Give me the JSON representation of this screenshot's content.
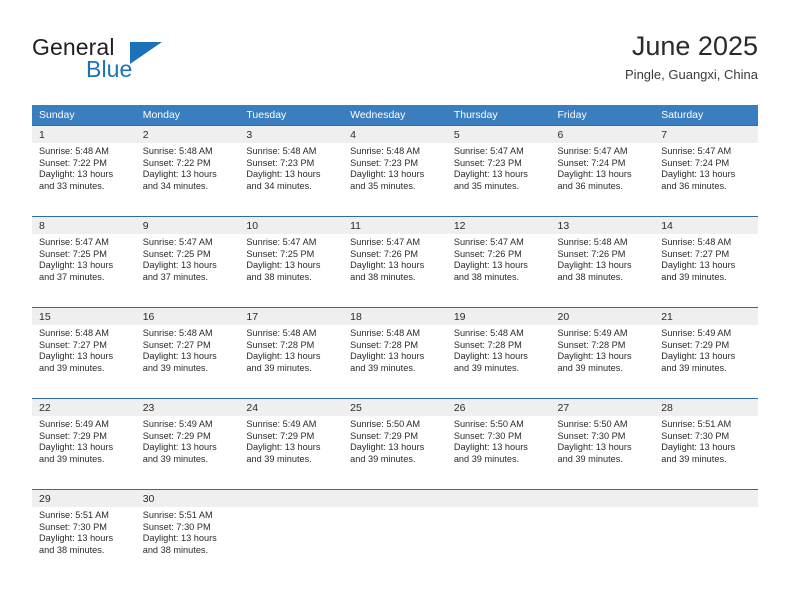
{
  "brand": {
    "name_top": "General",
    "name_bottom": "Blue",
    "accent_color": "#1b72b8"
  },
  "header": {
    "month_title": "June 2025",
    "location": "Pingle, Guangxi, China"
  },
  "theme": {
    "header_row_bg": "#3a7ec0",
    "row_divider": "#2c6ca8",
    "daynum_band_bg": "#efefef",
    "text_color": "#2b2b2b"
  },
  "calendar": {
    "weekday_headers": [
      "Sunday",
      "Monday",
      "Tuesday",
      "Wednesday",
      "Thursday",
      "Friday",
      "Saturday"
    ],
    "weeks": [
      [
        {
          "day": "1",
          "sunrise": "Sunrise: 5:48 AM",
          "sunset": "Sunset: 7:22 PM",
          "daylight_1": "Daylight: 13 hours",
          "daylight_2": "and 33 minutes."
        },
        {
          "day": "2",
          "sunrise": "Sunrise: 5:48 AM",
          "sunset": "Sunset: 7:22 PM",
          "daylight_1": "Daylight: 13 hours",
          "daylight_2": "and 34 minutes."
        },
        {
          "day": "3",
          "sunrise": "Sunrise: 5:48 AM",
          "sunset": "Sunset: 7:23 PM",
          "daylight_1": "Daylight: 13 hours",
          "daylight_2": "and 34 minutes."
        },
        {
          "day": "4",
          "sunrise": "Sunrise: 5:48 AM",
          "sunset": "Sunset: 7:23 PM",
          "daylight_1": "Daylight: 13 hours",
          "daylight_2": "and 35 minutes."
        },
        {
          "day": "5",
          "sunrise": "Sunrise: 5:47 AM",
          "sunset": "Sunset: 7:23 PM",
          "daylight_1": "Daylight: 13 hours",
          "daylight_2": "and 35 minutes."
        },
        {
          "day": "6",
          "sunrise": "Sunrise: 5:47 AM",
          "sunset": "Sunset: 7:24 PM",
          "daylight_1": "Daylight: 13 hours",
          "daylight_2": "and 36 minutes."
        },
        {
          "day": "7",
          "sunrise": "Sunrise: 5:47 AM",
          "sunset": "Sunset: 7:24 PM",
          "daylight_1": "Daylight: 13 hours",
          "daylight_2": "and 36 minutes."
        }
      ],
      [
        {
          "day": "8",
          "sunrise": "Sunrise: 5:47 AM",
          "sunset": "Sunset: 7:25 PM",
          "daylight_1": "Daylight: 13 hours",
          "daylight_2": "and 37 minutes."
        },
        {
          "day": "9",
          "sunrise": "Sunrise: 5:47 AM",
          "sunset": "Sunset: 7:25 PM",
          "daylight_1": "Daylight: 13 hours",
          "daylight_2": "and 37 minutes."
        },
        {
          "day": "10",
          "sunrise": "Sunrise: 5:47 AM",
          "sunset": "Sunset: 7:25 PM",
          "daylight_1": "Daylight: 13 hours",
          "daylight_2": "and 38 minutes."
        },
        {
          "day": "11",
          "sunrise": "Sunrise: 5:47 AM",
          "sunset": "Sunset: 7:26 PM",
          "daylight_1": "Daylight: 13 hours",
          "daylight_2": "and 38 minutes."
        },
        {
          "day": "12",
          "sunrise": "Sunrise: 5:47 AM",
          "sunset": "Sunset: 7:26 PM",
          "daylight_1": "Daylight: 13 hours",
          "daylight_2": "and 38 minutes."
        },
        {
          "day": "13",
          "sunrise": "Sunrise: 5:48 AM",
          "sunset": "Sunset: 7:26 PM",
          "daylight_1": "Daylight: 13 hours",
          "daylight_2": "and 38 minutes."
        },
        {
          "day": "14",
          "sunrise": "Sunrise: 5:48 AM",
          "sunset": "Sunset: 7:27 PM",
          "daylight_1": "Daylight: 13 hours",
          "daylight_2": "and 39 minutes."
        }
      ],
      [
        {
          "day": "15",
          "sunrise": "Sunrise: 5:48 AM",
          "sunset": "Sunset: 7:27 PM",
          "daylight_1": "Daylight: 13 hours",
          "daylight_2": "and 39 minutes."
        },
        {
          "day": "16",
          "sunrise": "Sunrise: 5:48 AM",
          "sunset": "Sunset: 7:27 PM",
          "daylight_1": "Daylight: 13 hours",
          "daylight_2": "and 39 minutes."
        },
        {
          "day": "17",
          "sunrise": "Sunrise: 5:48 AM",
          "sunset": "Sunset: 7:28 PM",
          "daylight_1": "Daylight: 13 hours",
          "daylight_2": "and 39 minutes."
        },
        {
          "day": "18",
          "sunrise": "Sunrise: 5:48 AM",
          "sunset": "Sunset: 7:28 PM",
          "daylight_1": "Daylight: 13 hours",
          "daylight_2": "and 39 minutes."
        },
        {
          "day": "19",
          "sunrise": "Sunrise: 5:48 AM",
          "sunset": "Sunset: 7:28 PM",
          "daylight_1": "Daylight: 13 hours",
          "daylight_2": "and 39 minutes."
        },
        {
          "day": "20",
          "sunrise": "Sunrise: 5:49 AM",
          "sunset": "Sunset: 7:28 PM",
          "daylight_1": "Daylight: 13 hours",
          "daylight_2": "and 39 minutes."
        },
        {
          "day": "21",
          "sunrise": "Sunrise: 5:49 AM",
          "sunset": "Sunset: 7:29 PM",
          "daylight_1": "Daylight: 13 hours",
          "daylight_2": "and 39 minutes."
        }
      ],
      [
        {
          "day": "22",
          "sunrise": "Sunrise: 5:49 AM",
          "sunset": "Sunset: 7:29 PM",
          "daylight_1": "Daylight: 13 hours",
          "daylight_2": "and 39 minutes."
        },
        {
          "day": "23",
          "sunrise": "Sunrise: 5:49 AM",
          "sunset": "Sunset: 7:29 PM",
          "daylight_1": "Daylight: 13 hours",
          "daylight_2": "and 39 minutes."
        },
        {
          "day": "24",
          "sunrise": "Sunrise: 5:49 AM",
          "sunset": "Sunset: 7:29 PM",
          "daylight_1": "Daylight: 13 hours",
          "daylight_2": "and 39 minutes."
        },
        {
          "day": "25",
          "sunrise": "Sunrise: 5:50 AM",
          "sunset": "Sunset: 7:29 PM",
          "daylight_1": "Daylight: 13 hours",
          "daylight_2": "and 39 minutes."
        },
        {
          "day": "26",
          "sunrise": "Sunrise: 5:50 AM",
          "sunset": "Sunset: 7:30 PM",
          "daylight_1": "Daylight: 13 hours",
          "daylight_2": "and 39 minutes."
        },
        {
          "day": "27",
          "sunrise": "Sunrise: 5:50 AM",
          "sunset": "Sunset: 7:30 PM",
          "daylight_1": "Daylight: 13 hours",
          "daylight_2": "and 39 minutes."
        },
        {
          "day": "28",
          "sunrise": "Sunrise: 5:51 AM",
          "sunset": "Sunset: 7:30 PM",
          "daylight_1": "Daylight: 13 hours",
          "daylight_2": "and 39 minutes."
        }
      ],
      [
        {
          "day": "29",
          "sunrise": "Sunrise: 5:51 AM",
          "sunset": "Sunset: 7:30 PM",
          "daylight_1": "Daylight: 13 hours",
          "daylight_2": "and 38 minutes."
        },
        {
          "day": "30",
          "sunrise": "Sunrise: 5:51 AM",
          "sunset": "Sunset: 7:30 PM",
          "daylight_1": "Daylight: 13 hours",
          "daylight_2": "and 38 minutes."
        },
        {
          "day": "",
          "sunrise": "",
          "sunset": "",
          "daylight_1": "",
          "daylight_2": ""
        },
        {
          "day": "",
          "sunrise": "",
          "sunset": "",
          "daylight_1": "",
          "daylight_2": ""
        },
        {
          "day": "",
          "sunrise": "",
          "sunset": "",
          "daylight_1": "",
          "daylight_2": ""
        },
        {
          "day": "",
          "sunrise": "",
          "sunset": "",
          "daylight_1": "",
          "daylight_2": ""
        },
        {
          "day": "",
          "sunrise": "",
          "sunset": "",
          "daylight_1": "",
          "daylight_2": ""
        }
      ]
    ]
  }
}
